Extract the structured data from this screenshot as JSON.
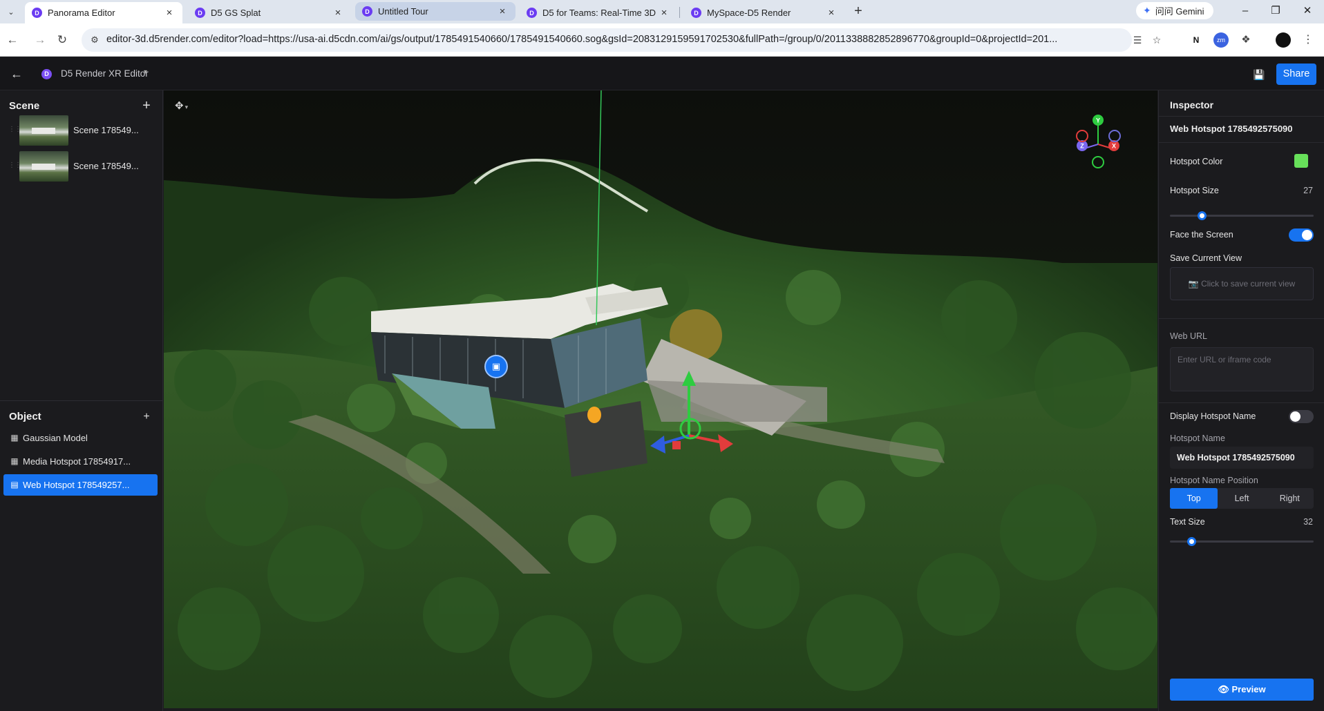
{
  "browser": {
    "tabs": [
      {
        "label": "Panorama Editor",
        "state": "active"
      },
      {
        "label": "D5 GS Splat",
        "state": "normal"
      },
      {
        "label": "Untitled Tour",
        "state": "hover"
      },
      {
        "label": "D5 for Teams: Real-Time 3D",
        "state": "normal"
      },
      {
        "label": "MySpace-D5 Render",
        "state": "normal"
      }
    ],
    "gemini_label": "问问 Gemini",
    "url": "editor-3d.d5render.com/editor?load=https://usa-ai.d5cdn.com/ai/gs/output/1785491540660/1785491540660.sog&gsId=2083129159591702530&fullPath=/group/0/2011338882852896770&groupId=0&projectId=201..."
  },
  "app": {
    "title": "D5 Render XR Editor",
    "share_label": "Share"
  },
  "scene_panel": {
    "title": "Scene",
    "items": [
      {
        "label": "Scene 178549..."
      },
      {
        "label": "Scene 178549..."
      }
    ]
  },
  "object_panel": {
    "title": "Object",
    "items": [
      {
        "label": "Gaussian Model",
        "icon": "gaussian-icon",
        "selected": false
      },
      {
        "label": "Media Hotspot 17854917...",
        "icon": "media-hotspot-icon",
        "selected": false
      },
      {
        "label": "Web Hotspot 178549257...",
        "icon": "web-hotspot-icon",
        "selected": true
      }
    ]
  },
  "gizmo": {
    "y": "Y",
    "x": "X",
    "z": "Z"
  },
  "inspector": {
    "title": "Inspector",
    "object_name": "Web Hotspot 1785492575090",
    "hotspot_color_label": "Hotspot Color",
    "hotspot_color": "#67e05a",
    "hotspot_size_label": "Hotspot Size",
    "hotspot_size": "27",
    "hotspot_size_fraction": 0.22,
    "face_screen_label": "Face the Screen",
    "face_screen": true,
    "save_view_label": "Save Current View",
    "save_view_placeholder": "Click to save current view",
    "web_url_label": "Web URL",
    "web_url_placeholder": "Enter URL or iframe code",
    "display_name_label": "Display Hotspot Name",
    "display_name": false,
    "hotspot_name_label": "Hotspot Name",
    "hotspot_name_value": "Web Hotspot 1785492575090",
    "name_position_label": "Hotspot Name Position",
    "name_positions": [
      "Top",
      "Left",
      "Right"
    ],
    "name_position_selected": "Top",
    "text_size_label": "Text Size",
    "text_size": "32",
    "text_size_fraction": 0.15,
    "preview_label": "Preview"
  },
  "colors": {
    "accent": "#1773f0",
    "panel": "#1b1b1e"
  }
}
